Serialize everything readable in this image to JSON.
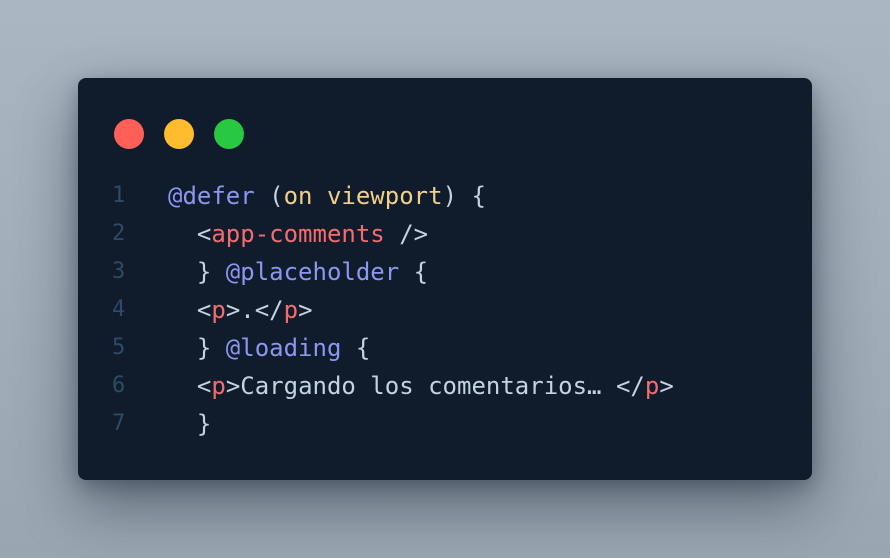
{
  "colors": {
    "close": "#ff5f57",
    "minimize": "#febc2e",
    "maximize": "#28c840"
  },
  "window_controls": {
    "close_icon": "close-dot",
    "minimize_icon": "minimize-dot",
    "maximize_icon": "maximize-dot"
  },
  "code": {
    "lines": [
      {
        "number": "1",
        "tokens": [
          {
            "type": "kw",
            "text": "@defer"
          },
          {
            "type": "punc",
            "text": " ("
          },
          {
            "type": "arg",
            "text": "on viewport"
          },
          {
            "type": "punc",
            "text": ") {"
          }
        ]
      },
      {
        "number": "2",
        "tokens": [
          {
            "type": "punc",
            "text": "  <"
          },
          {
            "type": "tag",
            "text": "app-comments"
          },
          {
            "type": "punc",
            "text": " />"
          }
        ]
      },
      {
        "number": "3",
        "tokens": [
          {
            "type": "punc",
            "text": "  } "
          },
          {
            "type": "kw",
            "text": "@placeholder"
          },
          {
            "type": "punc",
            "text": " {"
          }
        ]
      },
      {
        "number": "4",
        "tokens": [
          {
            "type": "punc",
            "text": "  <"
          },
          {
            "type": "tag",
            "text": "p"
          },
          {
            "type": "punc",
            "text": ">.</"
          },
          {
            "type": "tag",
            "text": "p"
          },
          {
            "type": "punc",
            "text": ">"
          }
        ]
      },
      {
        "number": "5",
        "tokens": [
          {
            "type": "punc",
            "text": "  } "
          },
          {
            "type": "kw",
            "text": "@loading"
          },
          {
            "type": "punc",
            "text": " {"
          }
        ]
      },
      {
        "number": "6",
        "tokens": [
          {
            "type": "punc",
            "text": "  <"
          },
          {
            "type": "tag",
            "text": "p"
          },
          {
            "type": "punc",
            "text": ">"
          },
          {
            "type": "txt",
            "text": "Cargando los comentarios… "
          },
          {
            "type": "punc",
            "text": "</"
          },
          {
            "type": "tag",
            "text": "p"
          },
          {
            "type": "punc",
            "text": ">"
          }
        ]
      },
      {
        "number": "7",
        "tokens": [
          {
            "type": "punc",
            "text": "  }"
          }
        ]
      }
    ]
  }
}
